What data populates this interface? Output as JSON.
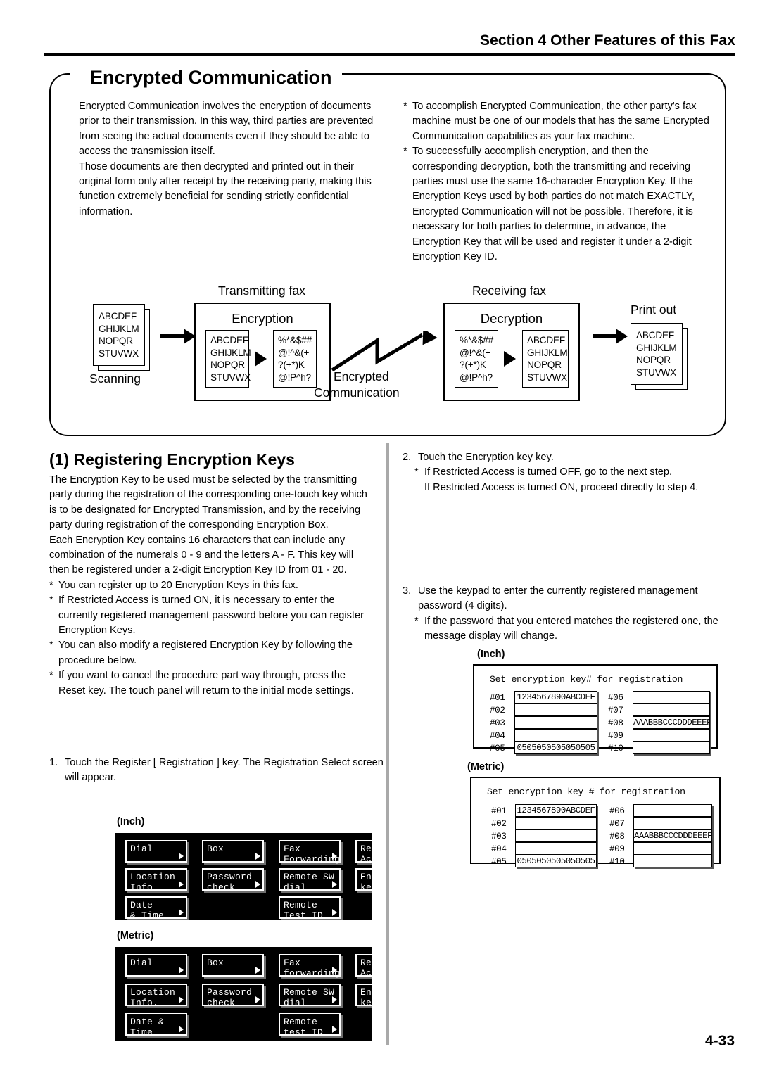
{
  "header": {
    "section_title": "Section 4 Other Features of this Fax"
  },
  "feature": {
    "title": "Encrypted Communication",
    "left_paragraphs": [
      "Encrypted Communication involves the encryption of documents prior to their transmission. In this way, third parties are prevented from seeing the actual documents even if they should be able to access the transmission itself.",
      "Those documents are then decrypted and printed out in their original form only after receipt by the receiving party, making this function extremely beneficial for sending strictly confidential information."
    ],
    "right_notes": [
      "To accomplish Encrypted Communication, the other party's fax machine must be one of our models that has the same Encrypted Communication capabilities as your fax machine.",
      "To successfully accomplish encryption, and then the corresponding decryption, both the transmitting and receiving parties must use the same 16-character Encryption Key. If the Encryption Keys used by both parties do not match EXACTLY, Encrypted Communication will not be possible. Therefore, it is necessary for both parties to determine, in advance, the Encryption Key that will be used and register it under a 2-digit Encryption Key ID."
    ]
  },
  "diagram": {
    "labels": {
      "scanning": "Scanning",
      "transmitting_fax": "Transmitting fax",
      "encryption": "Encryption",
      "encrypted_line1": "Encrypted",
      "encrypted_line2": "Communication",
      "receiving_fax": "Receiving fax",
      "decryption": "Decryption",
      "print_out": "Print out"
    },
    "plain_doc": [
      "ABCDEF",
      "GHIJKLM",
      "NOPQR",
      "STUVWX"
    ],
    "cipher_doc": [
      "%*&$##",
      "@!^&(+",
      "?(+*)K",
      "@!P^h?"
    ]
  },
  "section": {
    "heading": "(1) Registering Encryption Keys",
    "intro_paragraphs": [
      "The Encryption Key to be used must be selected by the transmitting party during the registration of the corresponding one-touch key which is to be designated for Encrypted Transmission, and by the receiving party during registration of the corresponding Encryption Box.",
      "Each Encryption Key contains 16 characters that can include any combination of the numerals 0 - 9 and the letters A - F. This key will then be registered under a 2-digit  Encryption Key ID  from 01 - 20."
    ],
    "notes": [
      "You can register up to 20 Encryption Keys in this fax.",
      "If Restricted Access is turned ON, it is necessary to enter the currently registered management password before you can register Encryption Keys.",
      "You can also modify a registered Encryption Key by following the procedure below.",
      "If you want to cancel the procedure part way through, press the Reset key. The touch panel will return to the initial mode settings."
    ]
  },
  "steps": {
    "step1": {
      "number": "1.",
      "text": "Touch the  Register  [ Registration ] key. The Registration Select screen will appear."
    },
    "step2": {
      "number": "2.",
      "text": "Touch the  Encryption key  key.",
      "notes": [
        "If Restricted Access is turned OFF, go to the next step.\nIf Restricted Access is turned ON, proceed directly to step 4."
      ]
    },
    "step3": {
      "number": "3.",
      "text": "Use the keypad to enter the currently registered management password (4 digits).",
      "notes": [
        "If the password that you entered matches the registered one, the message display will change."
      ]
    }
  },
  "unit_captions": {
    "inch": "(Inch)",
    "metric": "(Metric)"
  },
  "registration_panel_inch": {
    "keys": [
      [
        "Dial",
        ""
      ],
      [
        "Box",
        ""
      ],
      [
        "Fax",
        "Forwarding"
      ],
      [
        "Restricted",
        "Access"
      ],
      [
        "Location",
        "Info."
      ],
      [
        "Password",
        "check"
      ],
      [
        "Remote SW",
        "dial"
      ],
      [
        "Encryption",
        "key"
      ],
      [
        "Date",
        "& Time"
      ],
      [
        "Remote",
        "Test ID"
      ]
    ]
  },
  "registration_panel_metric": {
    "keys": [
      [
        "Dial",
        ""
      ],
      [
        "Box",
        ""
      ],
      [
        "Fax",
        "forwarding"
      ],
      [
        "Restricted",
        "Access"
      ],
      [
        "Location",
        "Info."
      ],
      [
        "Password",
        "check"
      ],
      [
        "Remote SW",
        "dial"
      ],
      [
        "Encryption",
        "key"
      ],
      [
        "Date &",
        "Time"
      ],
      [
        "Remote",
        "test ID"
      ]
    ]
  },
  "encryption_key_screen_inch": {
    "prompt": "Set encryption key# for registration",
    "left_rows": [
      {
        "id": "#01",
        "value": "1234567890ABCDEF"
      },
      {
        "id": "#02",
        "value": ""
      },
      {
        "id": "#03",
        "value": ""
      },
      {
        "id": "#04",
        "value": ""
      },
      {
        "id": "#05",
        "value": "0505050505050505"
      }
    ],
    "right_rows": [
      {
        "id": "#06",
        "value": ""
      },
      {
        "id": "#07",
        "value": ""
      },
      {
        "id": "#08",
        "value": "AAABBBCCCDDDEEEF"
      },
      {
        "id": "#09",
        "value": ""
      },
      {
        "id": "#10",
        "value": ""
      }
    ]
  },
  "encryption_key_screen_metric": {
    "prompt": "Set encryption key # for registration",
    "left_rows": [
      {
        "id": "#01",
        "value": "1234567890ABCDEF"
      },
      {
        "id": "#02",
        "value": ""
      },
      {
        "id": "#03",
        "value": ""
      },
      {
        "id": "#04",
        "value": ""
      },
      {
        "id": "#05",
        "value": "0505050505050505"
      }
    ],
    "right_rows": [
      {
        "id": "#06",
        "value": ""
      },
      {
        "id": "#07",
        "value": ""
      },
      {
        "id": "#08",
        "value": "AAABBBCCCDDDEEEF"
      },
      {
        "id": "#09",
        "value": ""
      },
      {
        "id": "#10",
        "value": ""
      }
    ]
  },
  "footer": {
    "page_number": "4-33"
  }
}
